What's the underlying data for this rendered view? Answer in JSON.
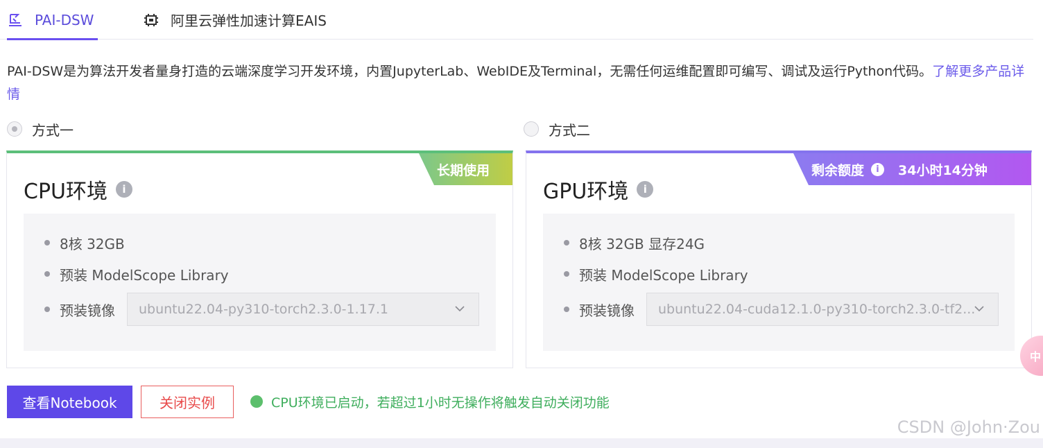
{
  "tabs": [
    {
      "label": "PAI-DSW",
      "active": true,
      "icon": "dsw-icon"
    },
    {
      "label": "阿里云弹性加速计算EAIS",
      "active": false,
      "icon": "chip-icon"
    }
  ],
  "description": {
    "text": "PAI-DSW是为算法开发者量身打造的云端深度学习开发环境，内置JupyterLab、WebIDE及Terminal，无需任何运维配置即可编写、调试及运行Python代码。",
    "link": "了解更多产品详情"
  },
  "options": {
    "option1": "方式一",
    "option2": "方式二"
  },
  "cpu_card": {
    "title": "CPU环境",
    "ribbon": "长期使用",
    "specs": [
      "8核 32GB",
      "预装 ModelScope Library"
    ],
    "image_label": "预装镜像",
    "image_value": "ubuntu22.04-py310-torch2.3.0-1.17.1"
  },
  "gpu_card": {
    "title": "GPU环境",
    "ribbon_label": "剩余额度",
    "ribbon_value": "34小时14分钟",
    "specs": [
      "8核 32GB 显存24G",
      "预装 ModelScope Library"
    ],
    "image_label": "预装镜像",
    "image_value": "ubuntu22.04-cuda12.1.0-py310-torch2.3.0-tf2..."
  },
  "actions": {
    "notebook": "查看Notebook",
    "close": "关闭实例",
    "status": "CPU环境已启动，若超过1小时无操作将触发自动关闭功能"
  },
  "float_chat": "中",
  "watermark": "CSDN @John·Zou",
  "colors": {
    "primary": "#5e48e8",
    "success": "#3fae5d",
    "danger": "#e84b4b",
    "cpu_accent": "#5cbf7a",
    "gpu_accent": "#8473ee"
  }
}
